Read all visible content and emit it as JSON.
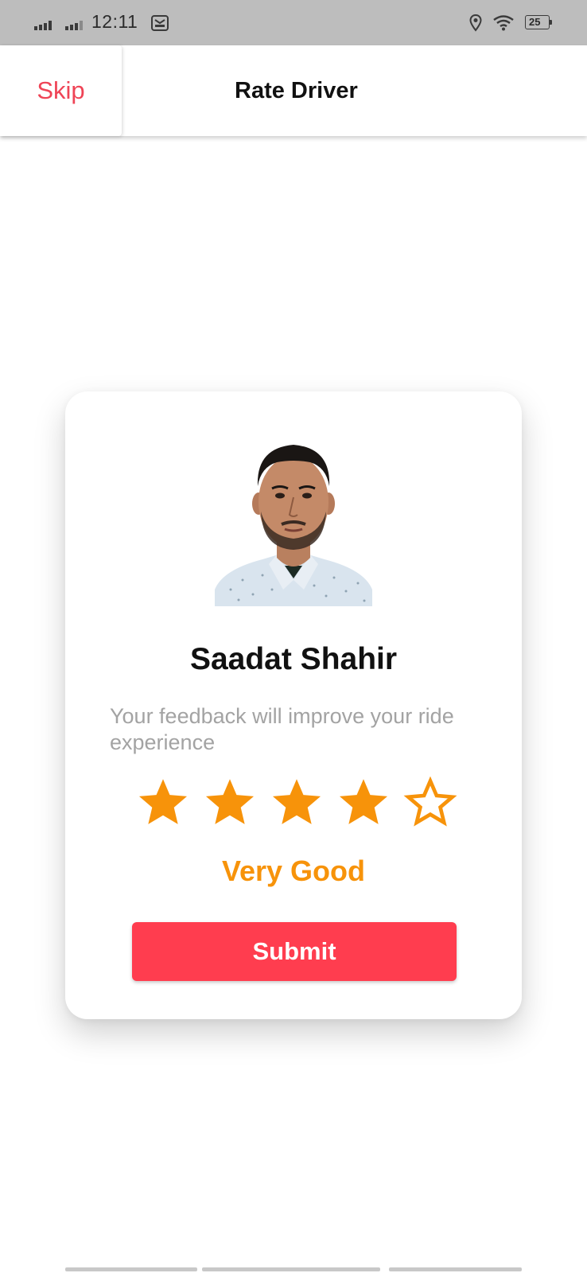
{
  "status_bar": {
    "time": "12:11",
    "battery_level": "25",
    "icons": [
      "signal-bars-icon",
      "signal-bars-icon",
      "message-icon",
      "location-pin-icon",
      "wifi-icon",
      "battery-icon"
    ]
  },
  "header": {
    "skip_label": "Skip",
    "title": "Rate Driver"
  },
  "card": {
    "driver_name": "Saadat Shahir",
    "feedback_prompt": "Your feedback will improve your ride experience",
    "rating": {
      "value": 4,
      "max": 5,
      "label": "Very Good"
    },
    "submit_label": "Submit"
  },
  "colors": {
    "accent_red": "#ff3d4f",
    "skip_red": "#ef4456",
    "star_orange": "#f7930a",
    "muted_text": "#a3a3a3",
    "status_bar_bg": "#bdbdbd"
  }
}
